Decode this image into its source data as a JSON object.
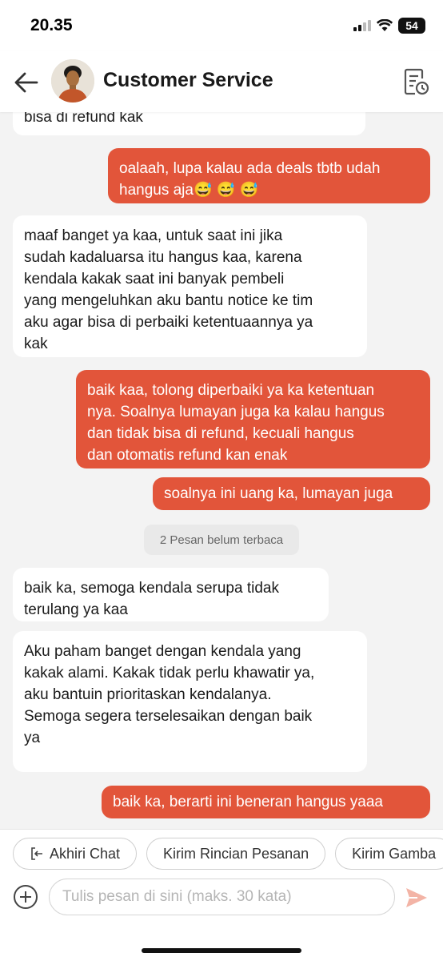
{
  "status_bar": {
    "time": "20.35",
    "battery": "54"
  },
  "header": {
    "title": "Customer Service",
    "back_icon": "arrow-left-icon",
    "history_icon": "document-clock-icon"
  },
  "messages": [
    {
      "side": "in",
      "text": "bisa di refund kak"
    },
    {
      "side": "out",
      "text": "oalaah, lupa kalau ada deals tbtb udah\nhangus aja😅 😅 😅"
    },
    {
      "side": "in",
      "text": "maaf banget ya kaa, untuk saat ini jika\nsudah kadaluarsa itu hangus kaa, karena\nkendala kakak saat ini banyak pembeli\nyang mengeluhkan aku bantu notice ke tim\naku agar bisa di perbaiki ketentuaannya ya\nkak"
    },
    {
      "side": "out",
      "text": "baik kaa, tolong diperbaiki ya ka ketentuan\nnya. Soalnya lumayan juga ka kalau hangus\ndan tidak bisa di refund, kecuali hangus\ndan otomatis refund kan enak"
    },
    {
      "side": "out",
      "text": "soalnya ini uang ka, lumayan juga"
    },
    {
      "side": "in",
      "text": "baik ka, semoga kendala serupa tidak\nterulang ya kaa"
    },
    {
      "side": "in",
      "text": "Aku paham banget dengan kendala yang\nkakak alami. Kakak tidak perlu khawatir ya,\naku bantuin prioritaskan kendalanya.\nSemoga segera terselesaikan dengan baik\nya"
    },
    {
      "side": "out",
      "text": "baik ka, berarti ini beneran hangus yaaa"
    }
  ],
  "unread_label": "2 Pesan belum terbaca",
  "quick_actions": [
    {
      "label": "Akhiri Chat",
      "icon": "exit-icon"
    },
    {
      "label": "Kirim Rincian Pesanan"
    },
    {
      "label": "Kirim Gamba"
    }
  ],
  "composer": {
    "placeholder": "Tulis pesan di sini (maks. 30 kata)"
  },
  "colors": {
    "accent": "#e2553a",
    "incoming_bubble": "#ffffff",
    "background": "#f3f3f3"
  }
}
